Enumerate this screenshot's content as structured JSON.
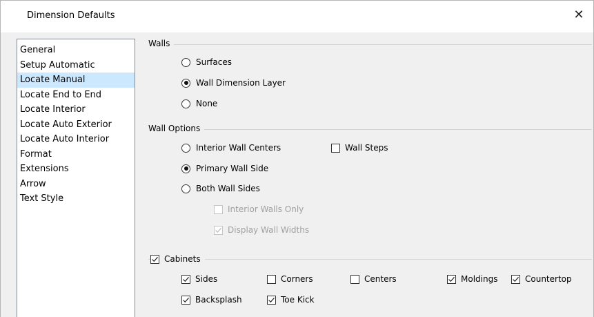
{
  "window": {
    "title": "Dimension Defaults",
    "close_glyph": "✕"
  },
  "sidebar": {
    "items": [
      {
        "label": "General"
      },
      {
        "label": "Setup Automatic"
      },
      {
        "label": "Locate Manual",
        "selected": true
      },
      {
        "label": "Locate End to End"
      },
      {
        "label": "Locate Interior"
      },
      {
        "label": "Locate Auto Exterior"
      },
      {
        "label": "Locate Auto Interior"
      },
      {
        "label": "Format"
      },
      {
        "label": "Extensions"
      },
      {
        "label": "Arrow"
      },
      {
        "label": "Text Style"
      }
    ]
  },
  "walls": {
    "label": "Walls",
    "options": [
      {
        "label": "Surfaces",
        "checked": false
      },
      {
        "label": "Wall Dimension Layer",
        "checked": true
      },
      {
        "label": "None",
        "checked": false
      }
    ]
  },
  "wall_options": {
    "label": "Wall Options",
    "radios": [
      {
        "label": "Interior Wall Centers",
        "checked": false
      },
      {
        "label": "Primary Wall Side",
        "checked": true
      },
      {
        "label": "Both Wall Sides",
        "checked": false
      }
    ],
    "wall_steps": {
      "label": "Wall Steps",
      "checked": false
    },
    "interior_walls_only": {
      "label": "Interior Walls Only",
      "checked": false,
      "disabled": true
    },
    "display_wall_widths": {
      "label": "Display Wall Widths",
      "checked": true,
      "disabled": true
    }
  },
  "cabinets": {
    "label": "Cabinets",
    "checked": true,
    "options": [
      {
        "label": "Sides",
        "checked": true
      },
      {
        "label": "Corners",
        "checked": false
      },
      {
        "label": "Centers",
        "checked": false
      },
      {
        "label": "Moldings",
        "checked": true
      },
      {
        "label": "Countertop",
        "checked": true
      },
      {
        "label": "Backsplash",
        "checked": true
      },
      {
        "label": "Toe Kick",
        "checked": true
      }
    ]
  }
}
